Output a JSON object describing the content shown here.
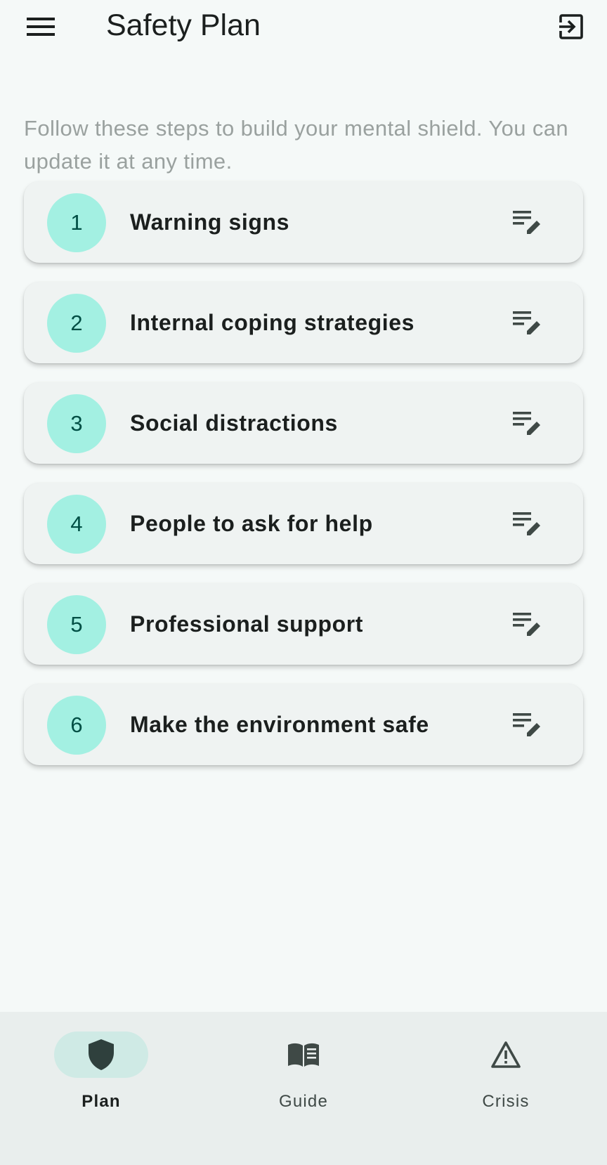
{
  "header": {
    "title": "Safety Plan",
    "menu_icon": "hamburger-menu-icon",
    "exit_icon": "exit-to-app-icon"
  },
  "intro_text": "Follow these steps to build your mental shield. You can update it at any time.",
  "steps": [
    {
      "number": "1",
      "label": "Warning signs",
      "action_icon": "edit-note-icon"
    },
    {
      "number": "2",
      "label": "Internal coping strategies",
      "action_icon": "edit-note-icon"
    },
    {
      "number": "3",
      "label": "Social distractions",
      "action_icon": "edit-note-icon"
    },
    {
      "number": "4",
      "label": "People to ask for help",
      "action_icon": "edit-note-icon"
    },
    {
      "number": "5",
      "label": "Professional support",
      "action_icon": "edit-note-icon"
    },
    {
      "number": "6",
      "label": "Make the environment safe",
      "action_icon": "edit-note-icon"
    }
  ],
  "bottom_nav": {
    "items": [
      {
        "label": "Plan",
        "icon": "shield-icon",
        "active": true
      },
      {
        "label": "Guide",
        "icon": "book-icon",
        "active": false
      },
      {
        "label": "Crisis",
        "icon": "warning-triangle-icon",
        "active": false
      }
    ]
  },
  "colors": {
    "background": "#f5f9f8",
    "card": "#eff3f2",
    "number_badge": "#a3f0e2",
    "number_text": "#004f45",
    "nav_background": "#e9eeed",
    "nav_active_pill": "#cfeae5",
    "intro_text": "#9aa19f"
  }
}
